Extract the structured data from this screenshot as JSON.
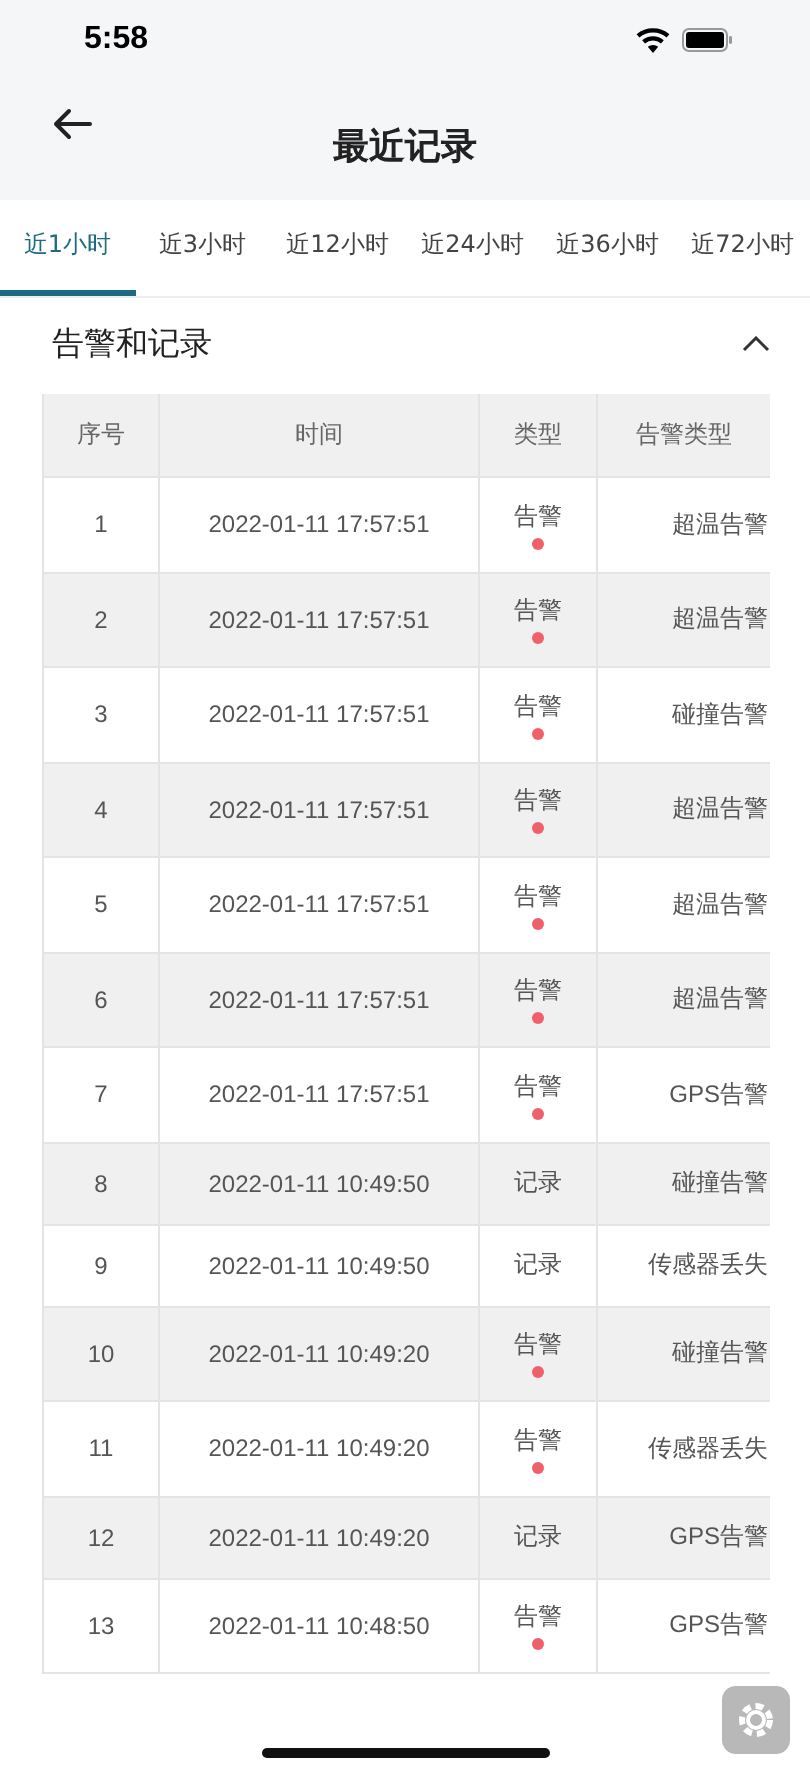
{
  "status_bar": {
    "time": "5:58"
  },
  "nav": {
    "title": "最近记录"
  },
  "tabs": [
    {
      "label": "近1小时",
      "selected": true
    },
    {
      "label": "近3小时",
      "selected": false
    },
    {
      "label": "近12小时",
      "selected": false
    },
    {
      "label": "近24小时",
      "selected": false
    },
    {
      "label": "近36小时",
      "selected": false
    },
    {
      "label": "近72小时",
      "selected": false
    }
  ],
  "section": {
    "title": "告警和记录",
    "expanded": true
  },
  "table": {
    "columns": [
      "序号",
      "时间",
      "类型",
      "告警类型"
    ],
    "rows": [
      {
        "no": "1",
        "time": "2022-01-11 17:57:51",
        "type": "告警",
        "alert": true,
        "alarm_type": "超温告警"
      },
      {
        "no": "2",
        "time": "2022-01-11 17:57:51",
        "type": "告警",
        "alert": true,
        "alarm_type": "超温告警"
      },
      {
        "no": "3",
        "time": "2022-01-11 17:57:51",
        "type": "告警",
        "alert": true,
        "alarm_type": "碰撞告警"
      },
      {
        "no": "4",
        "time": "2022-01-11 17:57:51",
        "type": "告警",
        "alert": true,
        "alarm_type": "超温告警"
      },
      {
        "no": "5",
        "time": "2022-01-11 17:57:51",
        "type": "告警",
        "alert": true,
        "alarm_type": "超温告警"
      },
      {
        "no": "6",
        "time": "2022-01-11 17:57:51",
        "type": "告警",
        "alert": true,
        "alarm_type": "超温告警"
      },
      {
        "no": "7",
        "time": "2022-01-11 17:57:51",
        "type": "告警",
        "alert": true,
        "alarm_type": "GPS告警"
      },
      {
        "no": "8",
        "time": "2022-01-11 10:49:50",
        "type": "记录",
        "alert": false,
        "alarm_type": "碰撞告警"
      },
      {
        "no": "9",
        "time": "2022-01-11 10:49:50",
        "type": "记录",
        "alert": false,
        "alarm_type": "传感器丢失"
      },
      {
        "no": "10",
        "time": "2022-01-11 10:49:20",
        "type": "告警",
        "alert": true,
        "alarm_type": "碰撞告警"
      },
      {
        "no": "11",
        "time": "2022-01-11 10:49:20",
        "type": "告警",
        "alert": true,
        "alarm_type": "传感器丢失"
      },
      {
        "no": "12",
        "time": "2022-01-11 10:49:20",
        "type": "记录",
        "alert": false,
        "alarm_type": "GPS告警"
      },
      {
        "no": "13",
        "time": "2022-01-11 10:48:50",
        "type": "告警",
        "alert": true,
        "alarm_type": "GPS告警"
      }
    ]
  }
}
